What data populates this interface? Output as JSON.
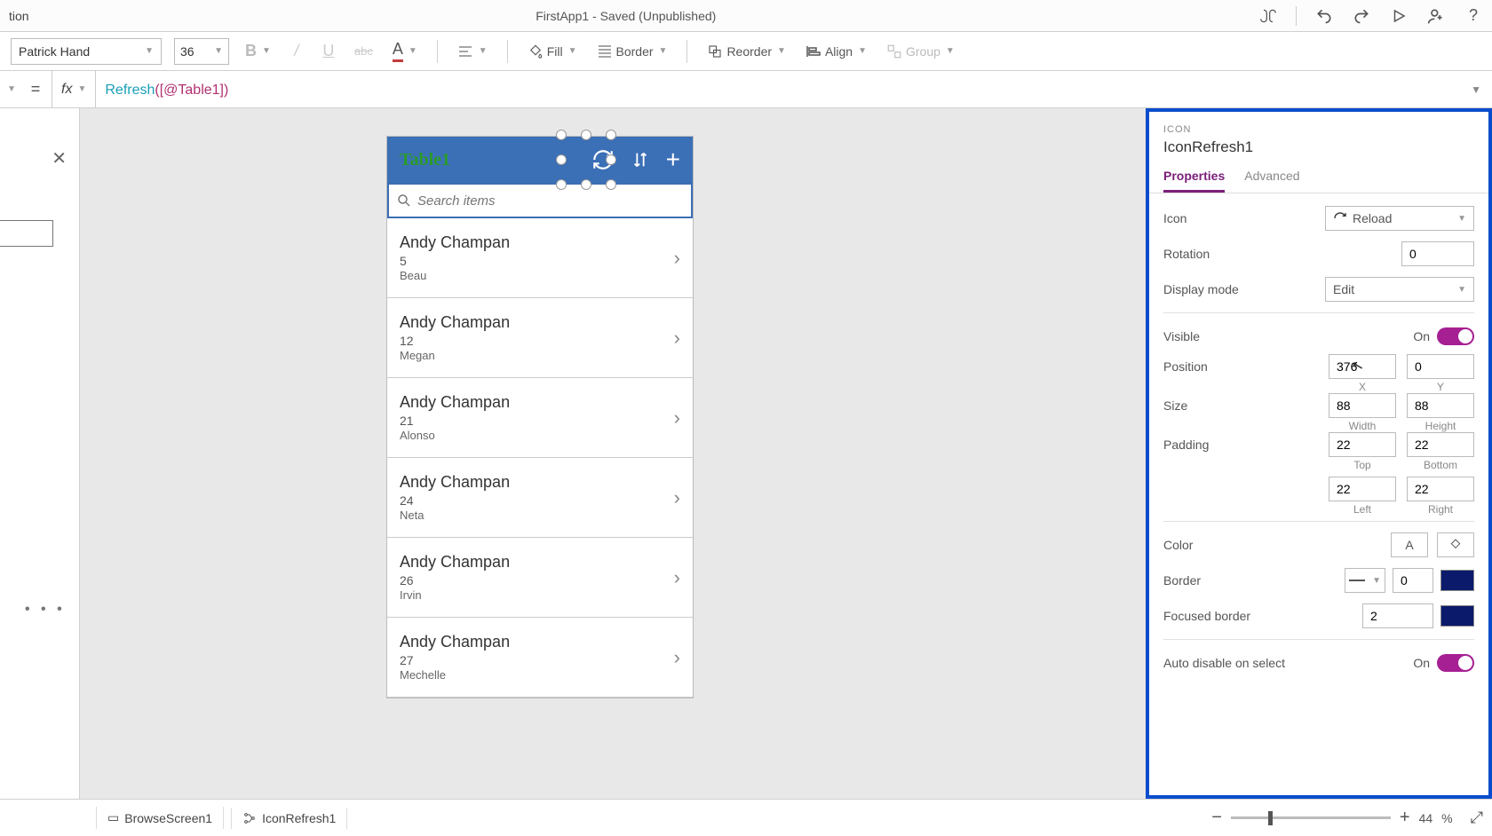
{
  "titlebar": {
    "left_fragment": "tion",
    "center": "FirstApp1 - Saved (Unpublished)"
  },
  "ribbon": {
    "font": "Patrick Hand",
    "size": "36",
    "fill": "Fill",
    "border": "Border",
    "reorder": "Reorder",
    "align": "Align",
    "group": "Group"
  },
  "formulabar": {
    "fx": "fx",
    "eq": "=",
    "fn": "Refresh",
    "arg": "([@Table1])"
  },
  "leftpane": {
    "dots": "• • •"
  },
  "phone": {
    "title": "Table1",
    "search_placeholder": "Search items",
    "items": [
      {
        "title": "Andy Champan",
        "num": "5",
        "name": "Beau"
      },
      {
        "title": "Andy Champan",
        "num": "12",
        "name": "Megan"
      },
      {
        "title": "Andy Champan",
        "num": "21",
        "name": "Alonso"
      },
      {
        "title": "Andy Champan",
        "num": "24",
        "name": "Neta"
      },
      {
        "title": "Andy Champan",
        "num": "26",
        "name": "Irvin"
      },
      {
        "title": "Andy Champan",
        "num": "27",
        "name": "Mechelle"
      }
    ]
  },
  "rightpanel": {
    "kind": "ICON",
    "name": "IconRefresh1",
    "tabs": {
      "properties": "Properties",
      "advanced": "Advanced"
    },
    "icon_label": "Icon",
    "icon_value": "Reload",
    "rotation_label": "Rotation",
    "rotation_value": "0",
    "displaymode_label": "Display mode",
    "displaymode_value": "Edit",
    "visible_label": "Visible",
    "visible_state": "On",
    "position_label": "Position",
    "position_x": "376",
    "position_y": "0",
    "x_label": "X",
    "y_label": "Y",
    "size_label": "Size",
    "size_w": "88",
    "size_h": "88",
    "w_label": "Width",
    "h_label": "Height",
    "padding_label": "Padding",
    "pad_t": "22",
    "pad_b": "22",
    "pad_l": "22",
    "pad_r": "22",
    "t_label": "Top",
    "b_label": "Bottom",
    "l_label": "Left",
    "r_label": "Right",
    "color_label": "Color",
    "border_label": "Border",
    "border_width": "0",
    "focused_label": "Focused border",
    "focused_width": "2",
    "autodisable_label": "Auto disable on select",
    "autodisable_state": "On"
  },
  "statusbar": {
    "crumb1": "BrowseScreen1",
    "crumb2": "IconRefresh1",
    "zoom_pct": "44",
    "pct_sym": "%"
  }
}
